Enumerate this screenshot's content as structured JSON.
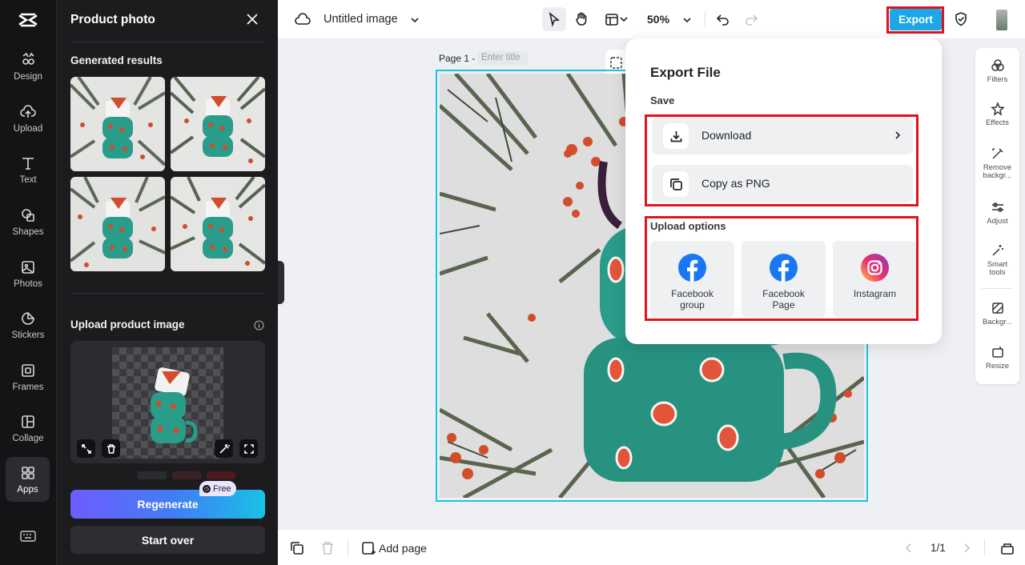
{
  "colors": {
    "accent": "#19c2e6",
    "export_button": "#1ba7e8",
    "highlight_box": "#e0141e",
    "facebook": "#1877f2"
  },
  "rail": {
    "logo": "capcut-logo-icon",
    "items": [
      {
        "label": "Design",
        "icon": "design-icon"
      },
      {
        "label": "Upload",
        "icon": "cloud-upload-icon"
      },
      {
        "label": "Text",
        "icon": "text-icon"
      },
      {
        "label": "Shapes",
        "icon": "shapes-icon"
      },
      {
        "label": "Photos",
        "icon": "photos-icon"
      },
      {
        "label": "Stickers",
        "icon": "stickers-icon"
      },
      {
        "label": "Frames",
        "icon": "frames-icon"
      },
      {
        "label": "Collage",
        "icon": "collage-icon"
      },
      {
        "label": "Apps",
        "icon": "apps-grid-icon",
        "active": true
      }
    ]
  },
  "panel": {
    "title": "Product photo",
    "generated_title": "Generated results",
    "upload_title": "Upload product image",
    "regenerate_label": "Regenerate",
    "free_badge": "Free",
    "start_over_label": "Start over"
  },
  "topbar": {
    "doc_title": "Untitled image",
    "zoom": "50%",
    "export_label": "Export"
  },
  "canvas": {
    "page_label": "Page 1 -",
    "page_title_placeholder": "Enter title"
  },
  "bottombar": {
    "add_page": "Add page",
    "pager": "1/1"
  },
  "right_tools": [
    {
      "label": "Filters",
      "icon": "filters-icon"
    },
    {
      "label": "Effects",
      "icon": "effects-icon"
    },
    {
      "label": "Remove backgr...",
      "icon": "remove-background-icon"
    },
    {
      "label": "Adjust",
      "icon": "adjust-icon"
    },
    {
      "label": "Smart tools",
      "icon": "smart-tools-icon"
    },
    {
      "label": "Backgr...",
      "icon": "background-icon"
    },
    {
      "label": "Resize",
      "icon": "resize-icon"
    }
  ],
  "export_popup": {
    "title": "Export File",
    "save_label": "Save",
    "download_label": "Download",
    "copy_png_label": "Copy as PNG",
    "upload_options_label": "Upload options",
    "targets": [
      {
        "label": "Facebook group",
        "icon": "facebook-icon"
      },
      {
        "label": "Facebook Page",
        "icon": "facebook-icon"
      },
      {
        "label": "Instagram",
        "icon": "instagram-icon"
      }
    ]
  }
}
